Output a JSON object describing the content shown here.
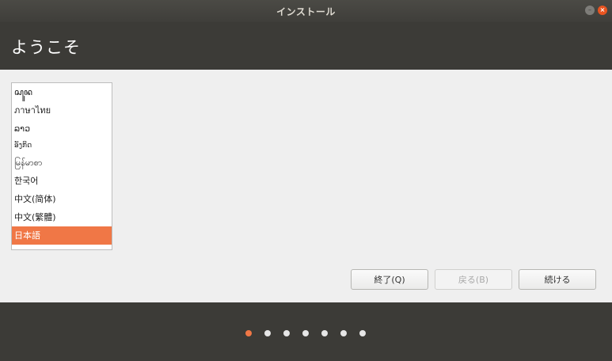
{
  "window": {
    "title": "インストール",
    "minimize_glyph": "–",
    "close_glyph": "×"
  },
  "header": {
    "title": "ようこそ"
  },
  "languages": [
    {
      "label": "ꦱꦸꦤ",
      "selected": false
    },
    {
      "label": "ภาษาไทย",
      "selected": false
    },
    {
      "label": "ລາວ",
      "selected": false
    },
    {
      "label": "ອັງກິດ",
      "selected": false
    },
    {
      "label": "မြန်မာစာ",
      "selected": false
    },
    {
      "label": "한국어",
      "selected": false
    },
    {
      "label": "中文(简体)",
      "selected": false
    },
    {
      "label": "中文(繁體)",
      "selected": false
    },
    {
      "label": "日本語",
      "selected": true
    }
  ],
  "buttons": {
    "quit": "終了(Q)",
    "back": "戻る(B)",
    "continue": "続ける"
  },
  "progress": {
    "total_steps": 7,
    "current_step": 1
  },
  "colors": {
    "accent": "#f07746",
    "header_bg": "#3c3b37",
    "content_bg": "#efefef"
  }
}
